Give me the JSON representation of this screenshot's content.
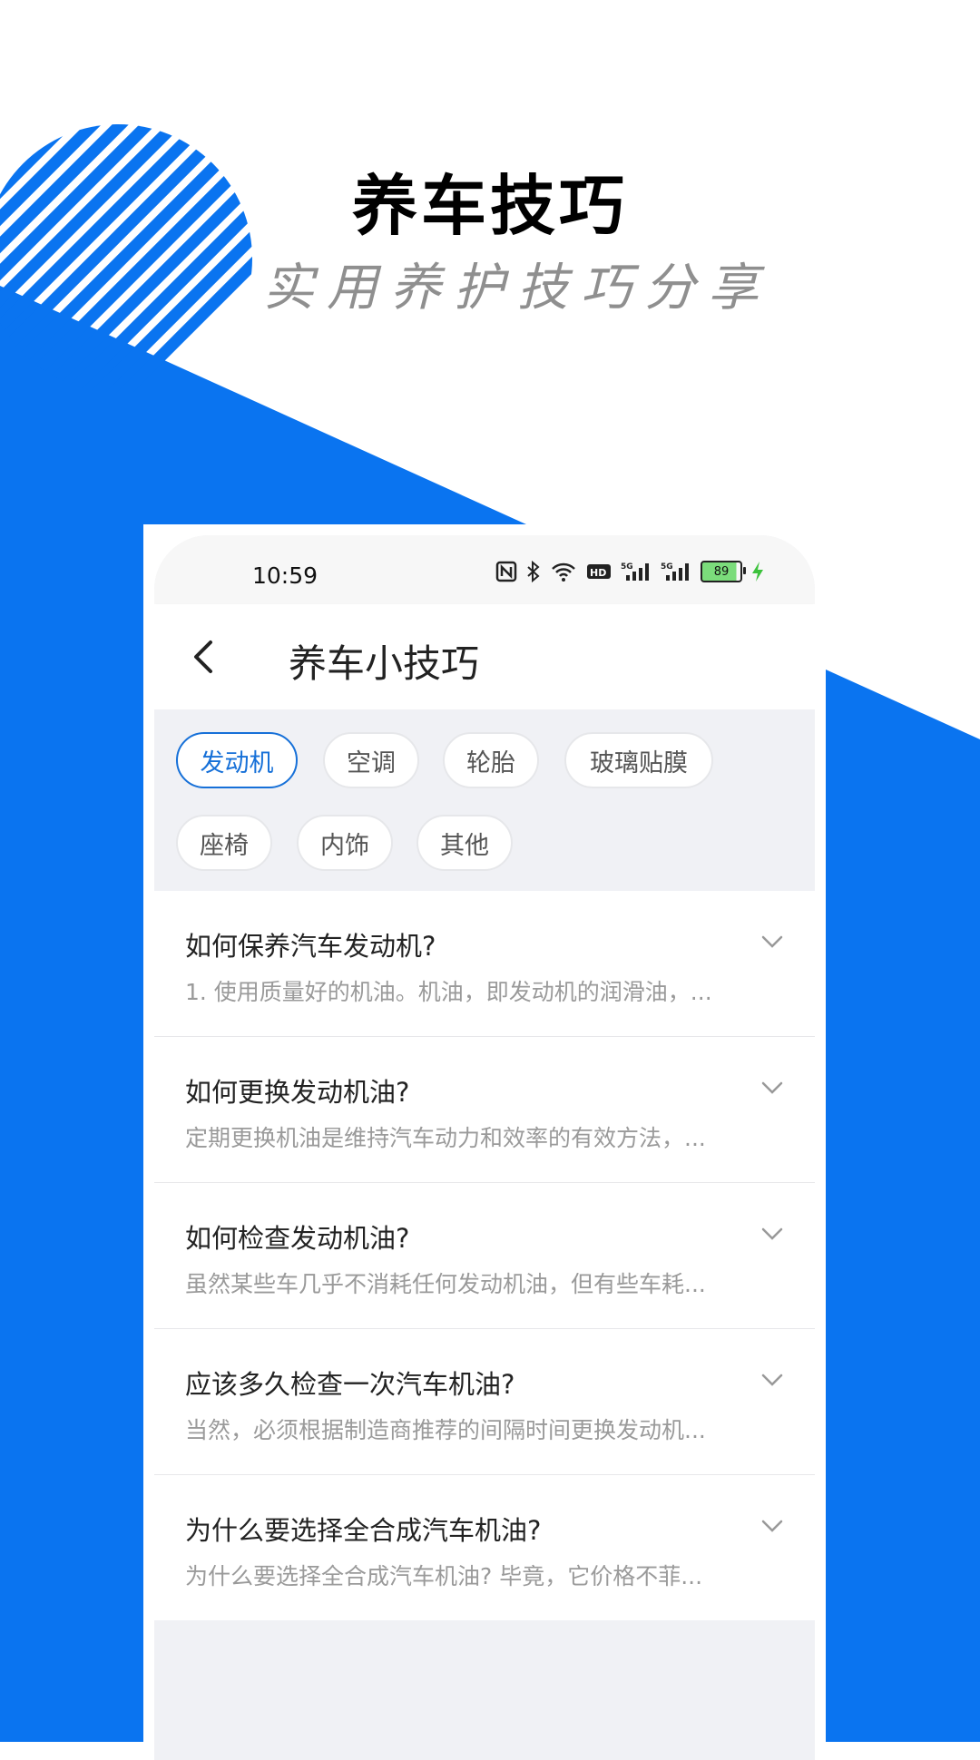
{
  "theme": {
    "accent": "#0a74f0",
    "chip_active": "#1670d8"
  },
  "promo": {
    "title": "养车技巧",
    "subtitle": "实用养护技巧分享"
  },
  "status_bar": {
    "time": "10:59",
    "battery": "89"
  },
  "app_bar": {
    "back_icon": "back-arrow-icon",
    "title": "养车小技巧"
  },
  "categories": [
    {
      "label": "发动机",
      "active": true
    },
    {
      "label": "空调",
      "active": false
    },
    {
      "label": "轮胎",
      "active": false
    },
    {
      "label": "玻璃贴膜",
      "active": false
    },
    {
      "label": "座椅",
      "active": false
    },
    {
      "label": "内饰",
      "active": false
    },
    {
      "label": "其他",
      "active": false
    }
  ],
  "faq": [
    {
      "question": "如何保养汽车发动机?",
      "answer": "1. 使用质量好的机油。机油，即发动机的润滑油，..."
    },
    {
      "question": "如何更换发动机油?",
      "answer": "定期更换机油是维持汽车动力和效率的有效方法，..."
    },
    {
      "question": "如何检查发动机油?",
      "answer": "虽然某些车几乎不消耗任何发动机油，但有些车耗..."
    },
    {
      "question": "应该多久检查一次汽车机油?",
      "answer": "当然，必须根据制造商推荐的间隔时间更换发动机..."
    },
    {
      "question": "为什么要选择全合成汽车机油?",
      "answer": "为什么要选择全合成汽车机油? 毕竟，它价格不菲..."
    }
  ]
}
